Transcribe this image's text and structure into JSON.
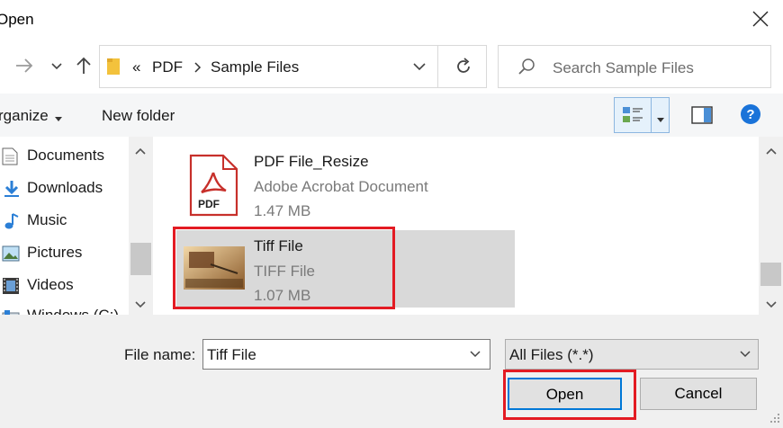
{
  "window": {
    "title": "Open"
  },
  "address": {
    "overflow": "«",
    "crumbs": [
      "PDF",
      "Sample Files"
    ]
  },
  "search": {
    "placeholder": "Search Sample Files"
  },
  "toolbar": {
    "organize": "rganize",
    "new_folder": "New folder"
  },
  "sidebar": {
    "items": [
      {
        "label": "Documents",
        "icon": "documents-icon"
      },
      {
        "label": "Downloads",
        "icon": "downloads-icon"
      },
      {
        "label": "Music",
        "icon": "music-icon"
      },
      {
        "label": "Pictures",
        "icon": "pictures-icon"
      },
      {
        "label": "Videos",
        "icon": "videos-icon"
      },
      {
        "label": "Windows (C:)",
        "icon": "drive-icon"
      }
    ]
  },
  "files": [
    {
      "name": "PDF File_Resize",
      "type": "Adobe Acrobat Document",
      "size": "1.47 MB",
      "icon": "pdf-icon",
      "badge": "PDF"
    },
    {
      "name": "Tiff File",
      "type": "TIFF File",
      "size": "1.07 MB",
      "icon": "tiff-thumbnail",
      "selected": true
    }
  ],
  "form": {
    "file_name_label": "File name:",
    "file_name_value": "Tiff File",
    "filter_value": "All Files (*.*)",
    "open_label": "Open",
    "cancel_label": "Cancel"
  },
  "colors": {
    "highlight": "#e31b23",
    "selected_row": "#d9d9d9",
    "focus_blue": "#0078d7"
  }
}
